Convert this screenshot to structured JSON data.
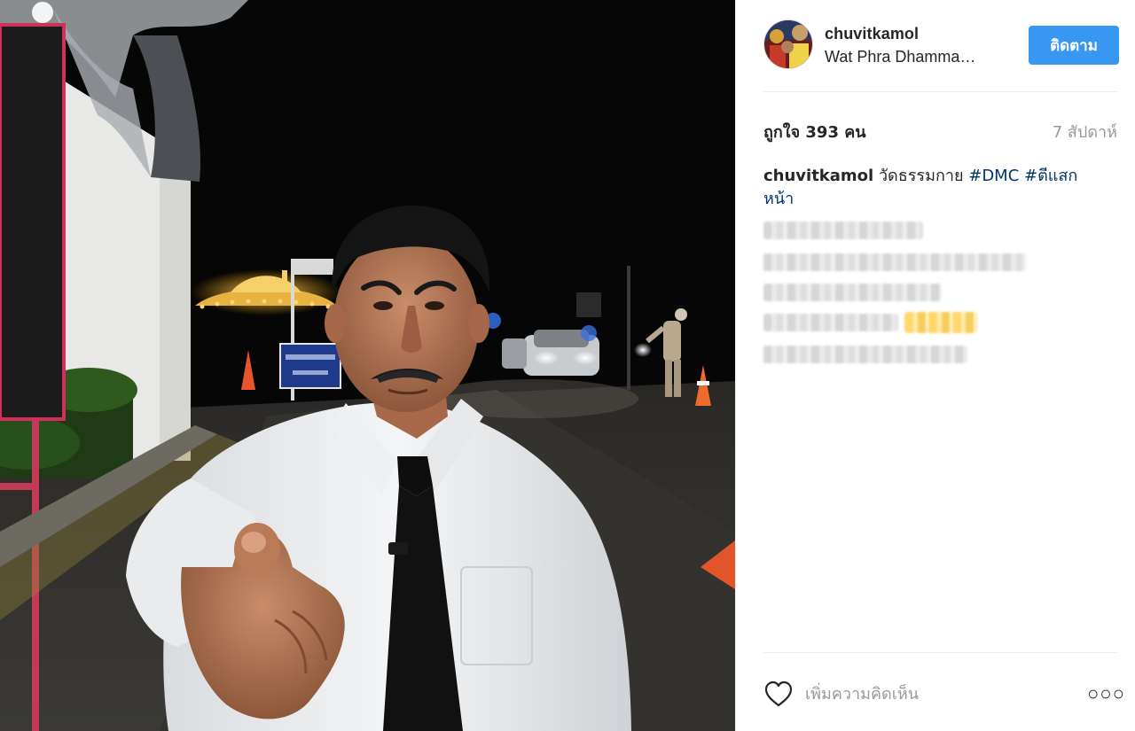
{
  "post": {
    "photo_alt": "",
    "username": "chuvitkamol",
    "location": "Wat Phra Dhamma…",
    "follow_label": "ติดตาม",
    "likes_text": "ถูกใจ 393 คน",
    "time_text": "7 สัปดาห์",
    "caption": {
      "user": "chuvitkamol",
      "text": "วัดธรรมกาย",
      "tags": [
        "#DMC",
        "#ตีแสกหน้า"
      ]
    },
    "comment_placeholder": "เพิ่มความคิดเห็น",
    "more_label": "○○○"
  },
  "icons": {
    "heart": "heart-outline-icon",
    "more": "more-horizontal-icon",
    "avatar": "profile-avatar"
  },
  "colors": {
    "follow_button": "#3897f0",
    "hashtag": "#003569",
    "muted_text": "#999999",
    "text": "#262626",
    "divider": "#efefef"
  }
}
